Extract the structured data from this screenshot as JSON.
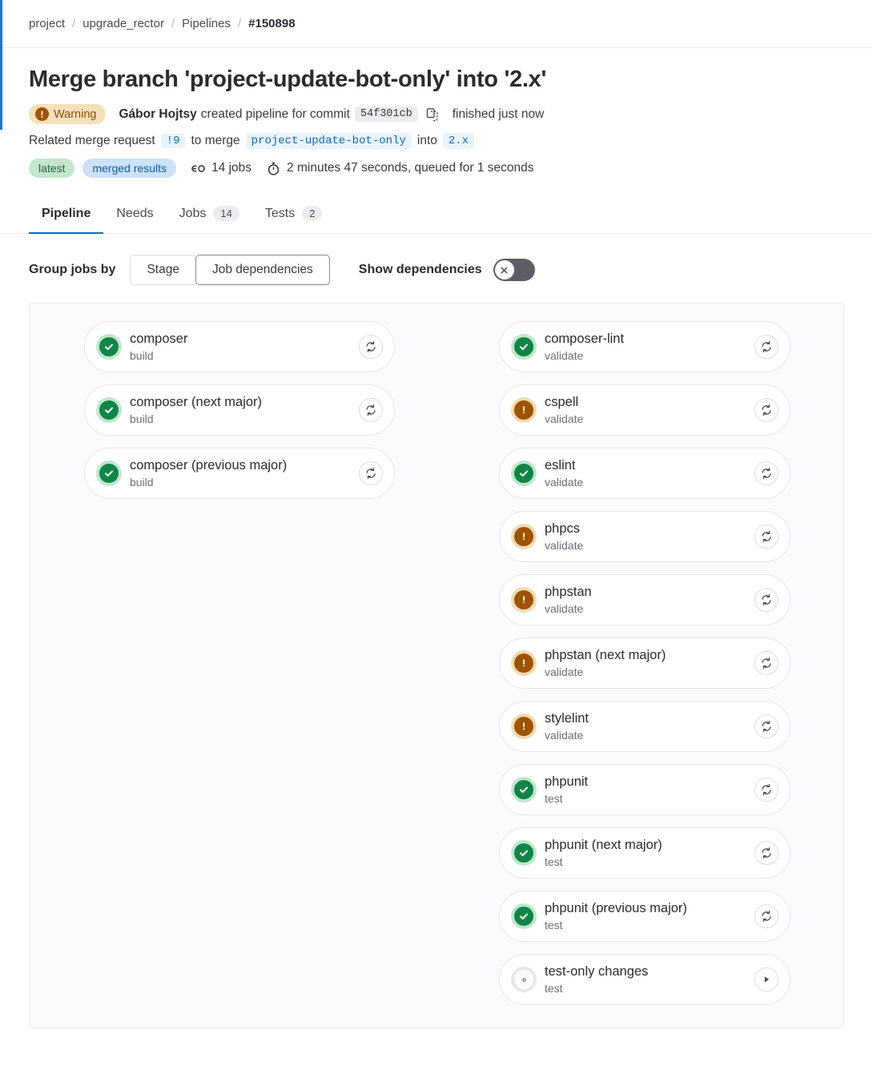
{
  "breadcrumb": {
    "items": [
      {
        "label": "project",
        "current": false
      },
      {
        "label": "upgrade_rector",
        "current": false
      },
      {
        "label": "Pipelines",
        "current": false
      },
      {
        "label": "#150898",
        "current": true
      }
    ],
    "separator": "/"
  },
  "header": {
    "title": "Merge branch 'project-update-bot-only' into '2.x'",
    "status_badge": "Warning",
    "author": "Gábor Hojtsy",
    "created_text": "created pipeline for commit",
    "commit_sha": "54f301cb",
    "finished_text": "finished just now",
    "related_label": "Related merge request",
    "mr_iid": "!9",
    "to_merge_text": "to merge",
    "source_branch": "project-update-bot-only",
    "into_text": "into",
    "target_branch": "2.x",
    "tag_latest": "latest",
    "tag_merged_results": "merged results",
    "jobs_count_text": "14 jobs",
    "duration_text": "2 minutes 47 seconds, queued for 1 seconds"
  },
  "tabs": [
    {
      "label": "Pipeline",
      "count": null,
      "active": true
    },
    {
      "label": "Needs",
      "count": null,
      "active": false
    },
    {
      "label": "Jobs",
      "count": "14",
      "active": false
    },
    {
      "label": "Tests",
      "count": "2",
      "active": false
    }
  ],
  "controls": {
    "group_label": "Group jobs by",
    "segment_stage": "Stage",
    "segment_job_dependencies": "Job dependencies",
    "selected_segment": "Job dependencies",
    "show_dependencies_label": "Show dependencies",
    "show_dependencies_on": false
  },
  "colors": {
    "success": "#108548",
    "warning": "#9e5400",
    "manual": "#89888d",
    "accent": "#1068bf"
  },
  "graph": {
    "columns": [
      {
        "jobs": [
          {
            "name": "composer",
            "stage": "build",
            "status": "success",
            "action": "retry-icon"
          },
          {
            "name": "composer (next major)",
            "stage": "build",
            "status": "success",
            "action": "retry-icon"
          },
          {
            "name": "composer (previous major)",
            "stage": "build",
            "status": "success",
            "action": "retry-icon"
          }
        ]
      },
      {
        "jobs": [
          {
            "name": "composer-lint",
            "stage": "validate",
            "status": "success",
            "action": "retry-icon"
          },
          {
            "name": "cspell",
            "stage": "validate",
            "status": "warning",
            "action": "retry-icon"
          },
          {
            "name": "eslint",
            "stage": "validate",
            "status": "success",
            "action": "retry-icon"
          },
          {
            "name": "phpcs",
            "stage": "validate",
            "status": "warning",
            "action": "retry-icon"
          },
          {
            "name": "phpstan",
            "stage": "validate",
            "status": "warning",
            "action": "retry-icon"
          },
          {
            "name": "phpstan (next major)",
            "stage": "validate",
            "status": "warning",
            "action": "retry-icon"
          },
          {
            "name": "stylelint",
            "stage": "validate",
            "status": "warning",
            "action": "retry-icon"
          },
          {
            "name": "phpunit",
            "stage": "test",
            "status": "success",
            "action": "retry-icon"
          },
          {
            "name": "phpunit (next major)",
            "stage": "test",
            "status": "success",
            "action": "retry-icon"
          },
          {
            "name": "phpunit (previous major)",
            "stage": "test",
            "status": "success",
            "action": "retry-icon"
          },
          {
            "name": "test-only changes",
            "stage": "test",
            "status": "manual",
            "action": "play-icon"
          }
        ]
      }
    ]
  }
}
